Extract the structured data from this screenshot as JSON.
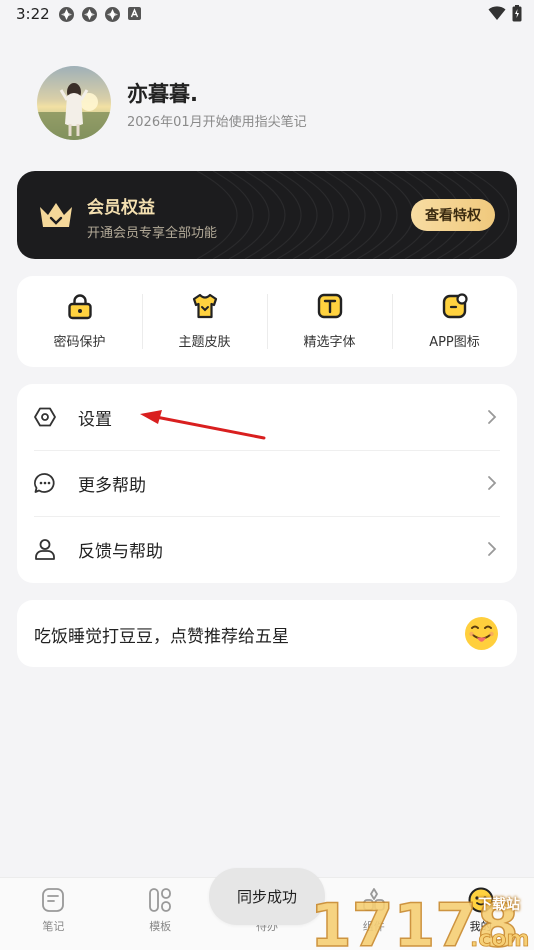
{
  "status_bar": {
    "time": "3:22",
    "icons": [
      "app-notification-icon",
      "app-notification-icon",
      "app-notification-icon",
      "keyboard-notification-icon",
      "wifi-icon",
      "battery-icon"
    ]
  },
  "profile": {
    "name": "亦暮暮.",
    "since": "2026年01月开始使用指尖笔记"
  },
  "vip": {
    "title": "会员权益",
    "subtitle": "开通会员专享全部功能",
    "button": "查看特权",
    "accent": "#f3dfb0"
  },
  "quick": {
    "items": [
      {
        "label": "密码保护",
        "icon": "lock-icon"
      },
      {
        "label": "主题皮肤",
        "icon": "shirt-icon"
      },
      {
        "label": "精选字体",
        "icon": "font-icon"
      },
      {
        "label": "APP图标",
        "icon": "app-icon"
      }
    ]
  },
  "menu": {
    "items": [
      {
        "label": "设置",
        "icon": "settings-hex-icon"
      },
      {
        "label": "更多帮助",
        "icon": "chat-bubble-icon"
      },
      {
        "label": "反馈与帮助",
        "icon": "person-icon"
      }
    ]
  },
  "rate": {
    "text": "吃饭睡觉打豆豆，点赞推荐给五星",
    "icon": "tongue-emoji-icon"
  },
  "toast": {
    "text": "同步成功"
  },
  "bottom_nav": {
    "items": [
      {
        "label": "笔记",
        "icon": "note-icon"
      },
      {
        "label": "模板",
        "icon": "template-icon"
      },
      {
        "label": "待办",
        "icon": "todo-icon"
      },
      {
        "label": "组件",
        "icon": "widget-icon"
      },
      {
        "label": "我的",
        "icon": "profile-emoji-icon"
      }
    ]
  },
  "watermark": {
    "number": "17178",
    "text": "下载站",
    "domain": ".com"
  },
  "colors": {
    "background": "#f4f4f6",
    "card": "#ffffff",
    "vip_card": "#1c1c1e",
    "vip_button": "#f0c97d",
    "annotation_arrow": "#d91f1f",
    "icon_yellow": "#ffd23f"
  }
}
